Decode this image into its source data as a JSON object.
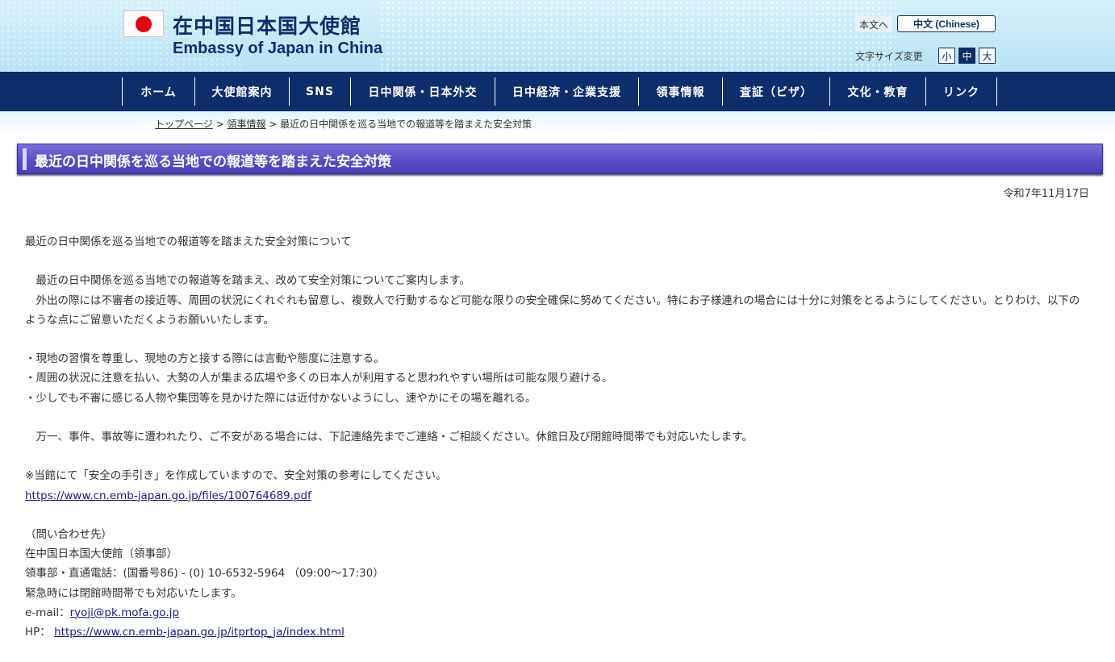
{
  "header": {
    "logo_ja": "在中国日本国大使館",
    "logo_en": "Embassy of Japan in China",
    "lang_ja": "本文へ",
    "lang_cn": "中文 (Chinese)",
    "font_size_label": "文字サイズ変更",
    "font_sizes": [
      "小",
      "中",
      "大"
    ],
    "flag_color": "#e60012"
  },
  "nav": {
    "items": [
      "ホーム",
      "大使館案内",
      "SNS",
      "日中関係・日本外交",
      "日中経済・企業支援",
      "領事情報",
      "査証（ビザ）",
      "文化・教育",
      "リンク"
    ]
  },
  "breadcrumb": {
    "top": "トップページ",
    "sep": " > ",
    "consular": "領事情報",
    "current": "最近の日中関係を巡る当地での報道等を踏まえた安全対策"
  },
  "page": {
    "title": "最近の日中関係を巡る当地での報道等を踏まえた安全対策",
    "date": "令和7年11月17日"
  },
  "content": {
    "heading": "最近の日中関係を巡る当地での報道等を踏まえた安全対策について",
    "para1": "　最近の日中関係を巡る当地での報道等を踏まえ、改めて安全対策についてご案内します。",
    "para2": "　外出の際には不審者の接近等、周囲の状況にくれぐれも留意し、複数人で行動するなど可能な限りの安全確保に努めてください。特にお子様連れの場合には十分に対策をとるようにしてください。とりわけ、以下のような点にご留意いただくようお願いいたします。",
    "bullets": [
      "・現地の習慣を尊重し、現地の方と接する際には言動や態度に注意する。",
      "・周囲の状況に注意を払い、大勢の人が集まる広場や多くの日本人が利用すると思われやすい場所は可能な限り避ける。",
      "・少しでも不審に感じる人物や集団等を見かけた際には近付かないようにし、速やかにその場を離れる。"
    ],
    "para3": "　万一、事件、事故等に遭われたり、ご不安がある場合には、下記連絡先までご連絡・ご相談ください。休館日及び閉館時間帯でも対応いたします。",
    "guide_note": "※当館にて「安全の手引き」を作成していますので、安全対策の参考にしてください。",
    "guide_link": "https://www.cn.emb-japan.go.jp/files/100764689.pdf",
    "contact_heading": "（問い合わせ先）",
    "contact_org": "在中国日本国大使館（領事部）",
    "contact_phone": "領事部・直通電話：(国番号86) - (0) 10-6532-5964 （09:00～17:30）",
    "contact_emergency": "緊急時には閉館時間帯でも対応いたします。",
    "email_label": "e-mail：",
    "email": "ryoji@pk.mofa.go.jp",
    "hp_label": "HP：",
    "hp_link": "https://www.cn.emb-japan.go.jp/itprtop_ja/index.html"
  }
}
